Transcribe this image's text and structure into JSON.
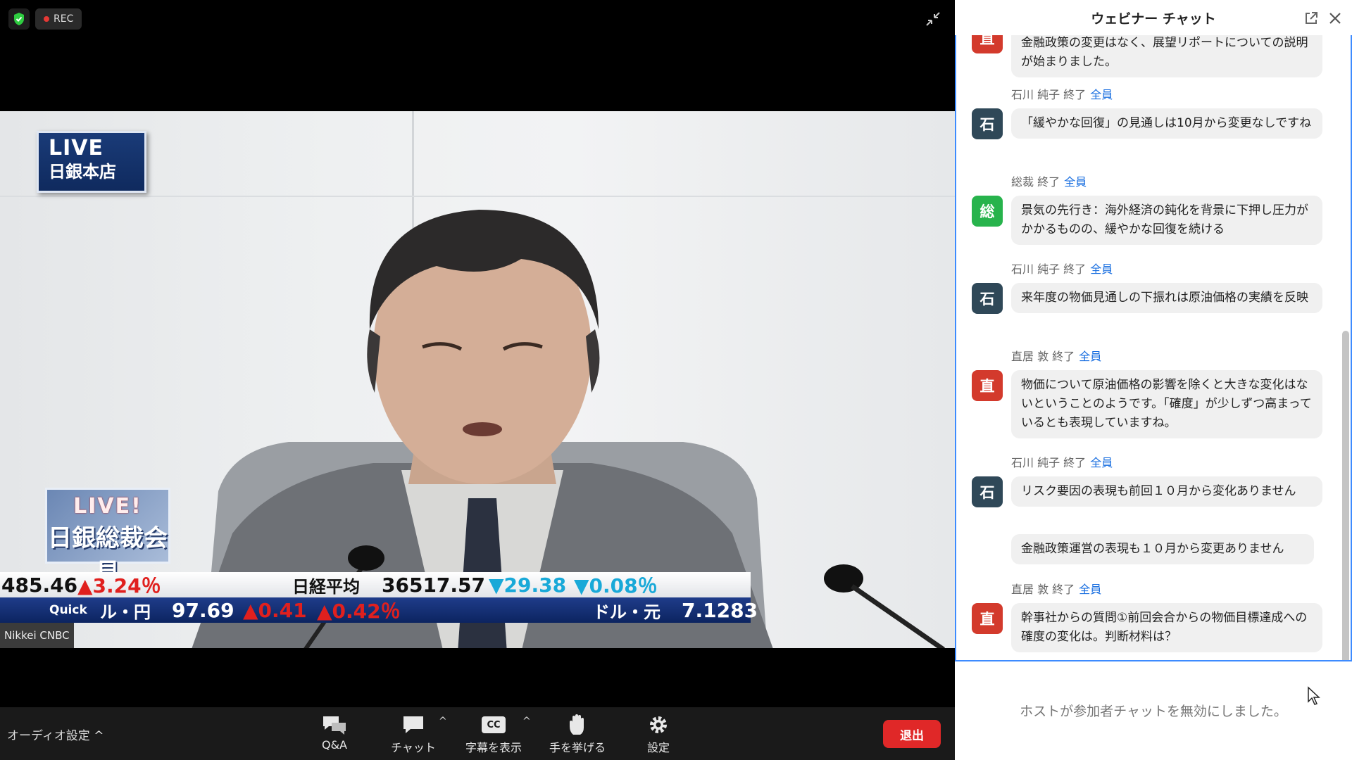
{
  "recording": {
    "label": "REC"
  },
  "stream": {
    "logo_live": "LIVE",
    "logo_place": "日銀本店",
    "logo2_live": "LIVE!",
    "logo2_title": "日銀総裁会見",
    "ticker_top": {
      "left_value": "485.46",
      "left_change": "▲3.24％",
      "index_name": "日経平均",
      "index_value": "36517.57",
      "index_change": "▼29.38",
      "index_pct": "▼0.08％"
    },
    "ticker_bottom": {
      "brand": "Quick",
      "pair1": "ル・円",
      "pair1_value": "97.69",
      "pair1_change": "▲0.41",
      "pair1_pct": "▲0.42％",
      "pair2": "ドル・元",
      "pair2_value": "7.1283"
    },
    "source": "Nikkei CNBC"
  },
  "toolbar": {
    "audio_settings": "オーディオ設定 ^",
    "qa": "Q&A",
    "chat": "チャット",
    "captions": "字幕を表示",
    "raise_hand": "手を挙げる",
    "settings": "設定",
    "leave": "退出",
    "cc_label": "CC"
  },
  "chat": {
    "title": "ウェビナー チャット",
    "recipient": "全員",
    "messages": [
      {
        "avatar": "直",
        "color": "nao",
        "text": "金融政策の変更はなく、展望リポートについての説明が始まりました。"
      },
      {
        "sender": "石川 純子 終了",
        "avatar": "石",
        "color": "ishi",
        "text": "「緩やかな回復」の見通しは10月から変更なしですね"
      },
      {
        "sender": "総裁 終了",
        "avatar": "総",
        "color": "so",
        "text": "景気の先行き：海外経済の鈍化を背景に下押し圧力がかかるものの、緩やかな回復を続ける"
      },
      {
        "sender": "石川 純子 終了",
        "avatar": "石",
        "color": "ishi",
        "text": "来年度の物価見通しの下振れは原油価格の実績を反映"
      },
      {
        "sender": "直居 敦 終了",
        "avatar": "直",
        "color": "nao",
        "text": "物価について原油価格の影響を除くと大きな変化はないということのようです。「確度」が少しずつ高まっているとも表現していますね。"
      },
      {
        "sender": "石川 純子 終了",
        "avatar": "石",
        "color": "ishi",
        "text": "リスク要因の表現も前回１０月から変化ありません"
      },
      {
        "text": "金融政策運営の表現も１０月から変更ありません"
      },
      {
        "sender": "直居 敦 終了",
        "avatar": "直",
        "color": "nao",
        "text": "幹事社からの質問①前回会合からの物価目標達成への確度の変化は。判断材料は？"
      }
    ],
    "disabled_notice": "ホストが参加者チャットを無効にしました。"
  }
}
